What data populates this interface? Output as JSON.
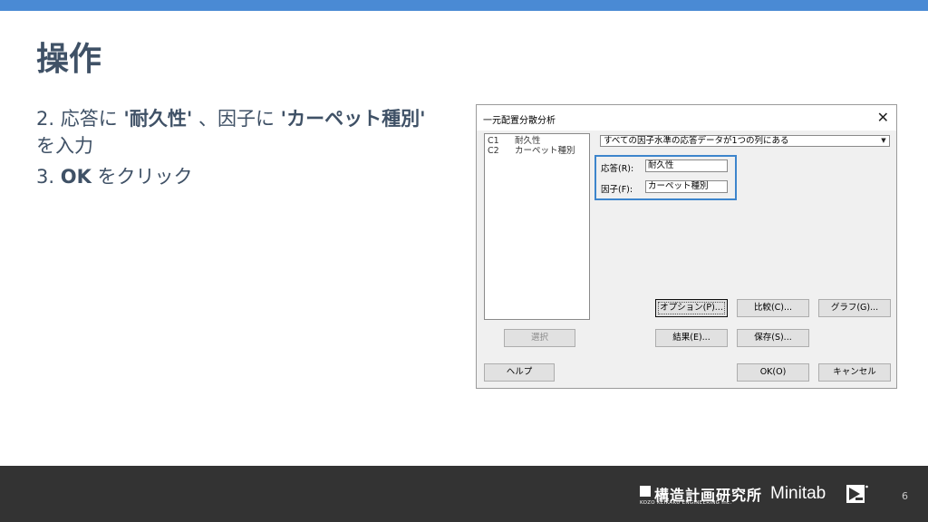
{
  "slide": {
    "title": "操作",
    "steps": [
      {
        "num": "2.",
        "pre": "応答に",
        "q1": "'耐久性'",
        "mid": "、因子に",
        "q2": "'カーペット種別'",
        "post": "を入力"
      },
      {
        "num": "3.",
        "pre": "",
        "q1": "OK",
        "mid": "",
        "q2": "",
        "post": "をクリック"
      }
    ],
    "page_number": "6"
  },
  "dialog": {
    "title": "一元配置分散分析",
    "close_glyph": "✕",
    "variables": [
      {
        "id": "C1",
        "name": "耐久性"
      },
      {
        "id": "C2",
        "name": "カーペット種別"
      }
    ],
    "layout_select": {
      "value": "すべての因子水準の応答データが1つの列にある"
    },
    "response": {
      "label": "応答(R):",
      "value": "耐久性"
    },
    "factor": {
      "label": "因子(F):",
      "value": "カーペット種別"
    },
    "buttons": {
      "options": "オプション(P)...",
      "compare": "比較(C)...",
      "graphs": "グラフ(G)...",
      "select": "選択",
      "results": "結果(E)...",
      "storage": "保存(S)...",
      "help": "ヘルプ",
      "ok": "OK(O)",
      "cancel": "キャンセル"
    }
  },
  "footer": {
    "company_name": "構造計画研究所",
    "company_sub": "KOZO KEIKAKU ENGINEERING Inc.",
    "brand": "Minitab"
  },
  "colors": {
    "top_bar": "#4a8ad4",
    "footer_bg": "#333333",
    "highlight": "#3d85cc",
    "text": "#3f5166"
  }
}
